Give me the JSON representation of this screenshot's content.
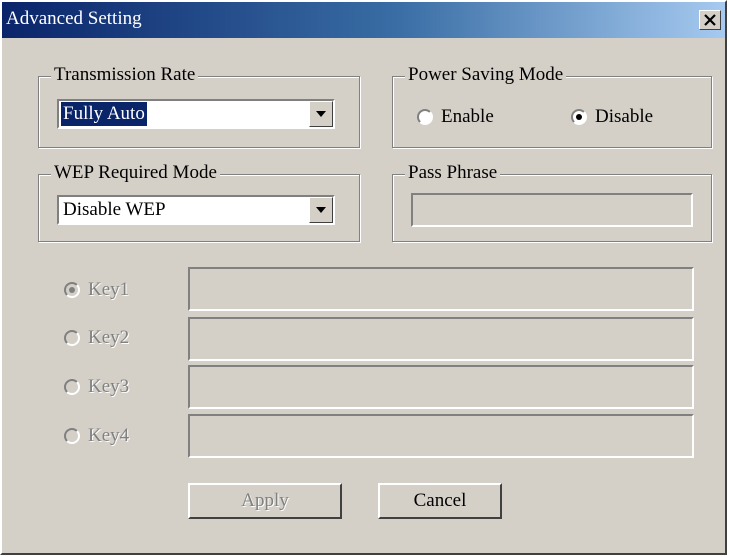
{
  "window": {
    "title": "Advanced Setting",
    "close_glyph": "✕"
  },
  "transmission_rate": {
    "legend": "Transmission Rate",
    "selected": "Fully Auto"
  },
  "power_saving": {
    "legend": "Power Saving Mode",
    "options": [
      "Enable",
      "Disable"
    ],
    "selected": "Disable"
  },
  "wep_mode": {
    "legend": "WEP Required Mode",
    "selected": "Disable WEP"
  },
  "pass_phrase": {
    "legend": "Pass Phrase",
    "value": ""
  },
  "keys": [
    {
      "label": "Key1",
      "selected": true,
      "value": ""
    },
    {
      "label": "Key2",
      "selected": false,
      "value": ""
    },
    {
      "label": "Key3",
      "selected": false,
      "value": ""
    },
    {
      "label": "Key4",
      "selected": false,
      "value": ""
    }
  ],
  "buttons": {
    "apply": "Apply",
    "cancel": "Cancel"
  },
  "colors": {
    "face": "#d4d0c8",
    "title_start": "#0a246a",
    "title_end": "#a6caf0",
    "disabled_text": "#808080"
  }
}
